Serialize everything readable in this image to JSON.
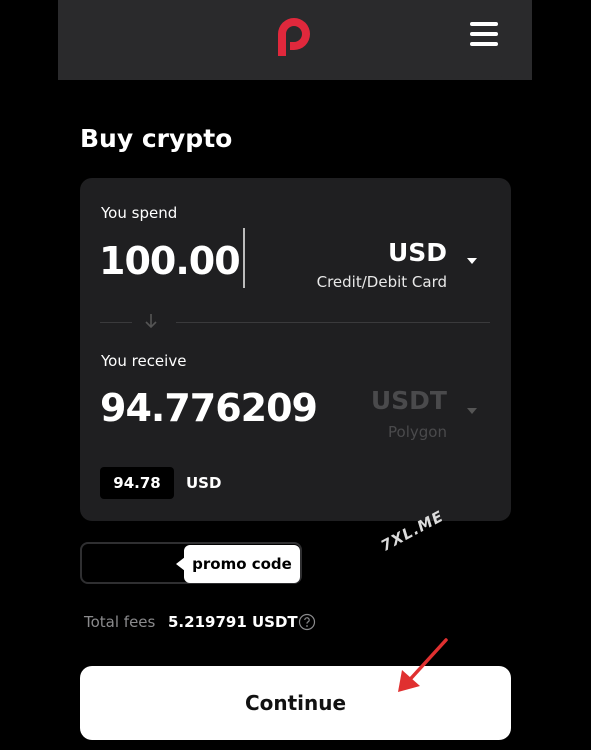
{
  "header": {
    "logo_icon": "brand-p-logo-icon",
    "menu_icon": "hamburger-menu-icon",
    "brand_color": "#e0283c"
  },
  "page": {
    "title": "Buy crypto"
  },
  "spend": {
    "label": "You spend",
    "amount": "100.00",
    "currency": "USD",
    "method": "Credit/Debit Card"
  },
  "receive": {
    "label": "You receive",
    "amount": "94.776209",
    "currency": "USDT",
    "network": "Polygon",
    "fiat_value": "94.78",
    "fiat_currency": "USD"
  },
  "promo": {
    "label": "promo code"
  },
  "watermark": "7XL.ME",
  "fees": {
    "label": "Total fees",
    "value": "5.219791 USDT"
  },
  "actions": {
    "continue_label": "Continue"
  },
  "annotation": {
    "arrow_color": "#e03030"
  }
}
